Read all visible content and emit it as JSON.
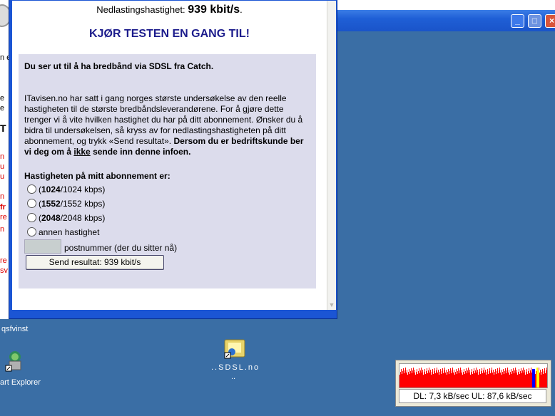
{
  "browser": {
    "speed_prefix": "Nedlastingshastighet:",
    "speed_value": "939 kbit/s",
    "speed_suffix": ".",
    "retest_link": "KJØR TESTEN EN GANG TIL!",
    "panel": {
      "heading": "Du ser ut til å ha bredbånd via SDSL fra Catch.",
      "para_1": "ITavisen.no har satt i gang norges største undersøkelse av den reelle hastigheten til de største bredbåndsleverandørene. For å gjøre dette trenger vi å vite hvilken hastighet du har på ditt abonnement. Ønsker du å bidra til undersøkelsen, så kryss av for nedlastingshastigheten på ditt abonnement, og trykk «Send resultat».",
      "para_bold_1": "Dersom du er bedriftskunde ber vi deg om å",
      "para_underlined": "ikke",
      "para_bold_2": "sende inn denne infoen.",
      "question": "Hastigheten på mitt abonnement er:",
      "options": [
        {
          "bold": "1024",
          "rest": "/1024 kbps)"
        },
        {
          "bold": "1552",
          "rest": "/1552 kbps)"
        },
        {
          "bold": "2048",
          "rest": "/2048 kbps)"
        }
      ],
      "option_other": "annen hastighet",
      "postcode_label": "postnummer (der du sitter nå)",
      "postcode_value": "",
      "submit_label": "Send resultat: 939 kbit/s"
    }
  },
  "left_fragments": [
    "n e",
    "e",
    "u",
    "u",
    "r",
    "T",
    "n",
    "n",
    "fr",
    "re",
    "n",
    "re",
    "sv"
  ],
  "desktop": {
    "label_qsfvinst": "qsfvinst",
    "label_ie": "art Explorer",
    "label_folder_1": "..SDSL.no",
    "label_folder_2": ".."
  },
  "meter": {
    "text": "DL: 7,3 kB/sec  UL: 87,6 kB/sec"
  },
  "colors": {
    "desktop": "#3a6ea5",
    "panel": "#dcdcec",
    "retest": "#1c1c8c",
    "graph_dl": "#ff0000",
    "graph_ul": "#0000ff",
    "graph_peak": "#ffff00"
  }
}
